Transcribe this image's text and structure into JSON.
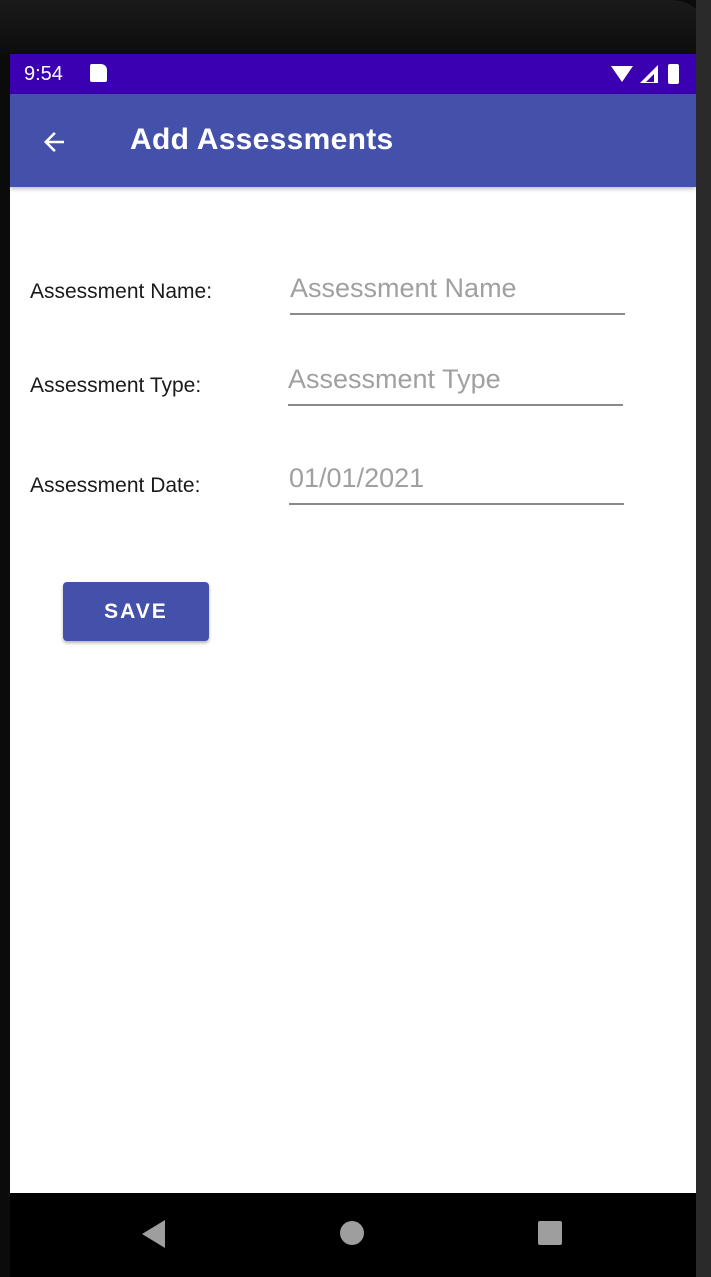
{
  "status_bar": {
    "time": "9:54",
    "icons": [
      "sd-card-icon",
      "wifi-icon",
      "signal-icon",
      "battery-icon"
    ],
    "color": "#3a00b1"
  },
  "app_bar": {
    "title": "Add Assessments",
    "back_icon": "arrow-left-icon",
    "color": "#4351ab"
  },
  "form": {
    "name": {
      "label": "Assessment Name:",
      "value": "",
      "placeholder": "Assessment Name"
    },
    "type": {
      "label": "Assessment Type:",
      "value": "",
      "placeholder": "Assessment Type"
    },
    "date": {
      "label": "Assessment Date:",
      "value": "",
      "placeholder": "01/01/2021"
    }
  },
  "save_button": {
    "label": "SAVE",
    "color": "#4351ab"
  },
  "nav_bar": {
    "icons": [
      "nav-back-icon",
      "nav-home-icon",
      "nav-recents-icon"
    ]
  }
}
